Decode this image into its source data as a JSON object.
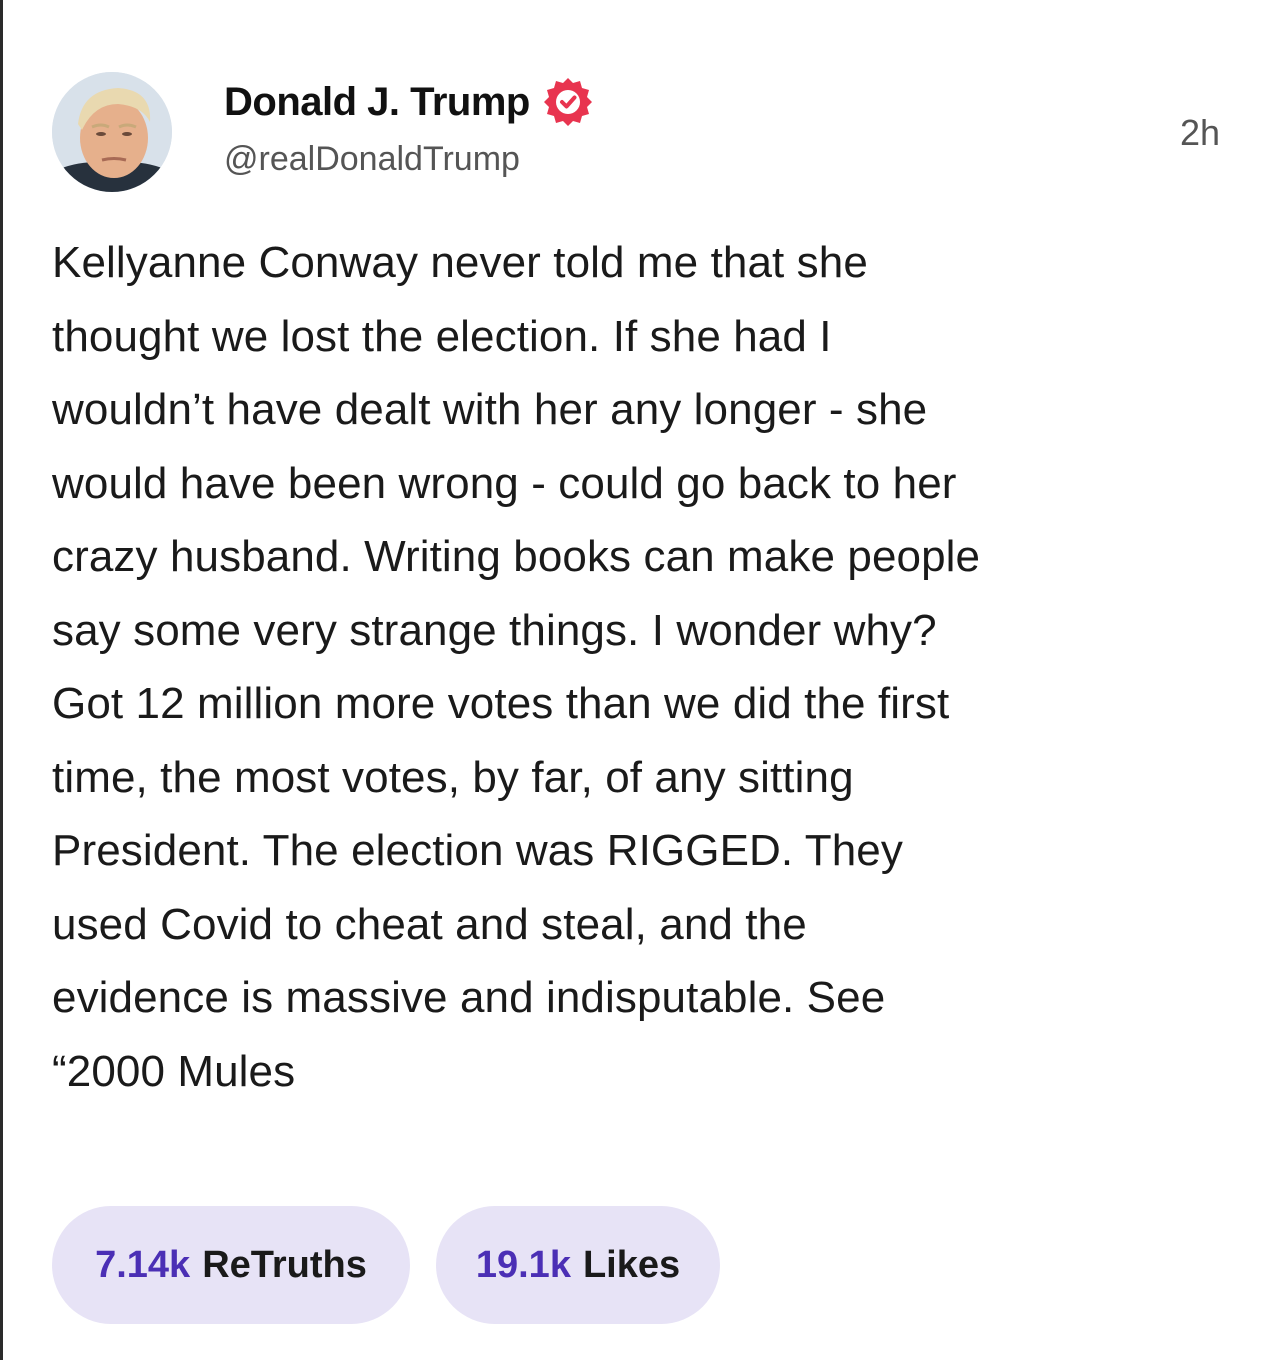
{
  "post": {
    "author": {
      "display_name": "Donald J. Trump",
      "handle": "@realDonaldTrump",
      "verified": true,
      "verified_color": "#e8344f"
    },
    "timestamp": "2h",
    "body": "Kellyanne Conway never told me that she\nthought we lost the election. If she had I\nwouldn’t have dealt with her any longer - she\nwould have been wrong - could go back to her\ncrazy husband. Writing books can make people\nsay some very strange things. I wonder why?\nGot 12 million more votes than we did the first\ntime, the most votes, by far, of any sitting\nPresident. The election was RIGGED. They\nused Covid to cheat and steal, and the\nevidence is massive and indisputable. See\n“2000 Mules",
    "stats": {
      "retruths_count": "7.14k",
      "retruths_label": "ReTruths",
      "likes_count": "19.1k",
      "likes_label": "Likes"
    }
  },
  "colors": {
    "accent": "#4b2fb5",
    "pill_background": "#e7e3f6",
    "text": "#1a1a1a",
    "muted": "#555555"
  }
}
